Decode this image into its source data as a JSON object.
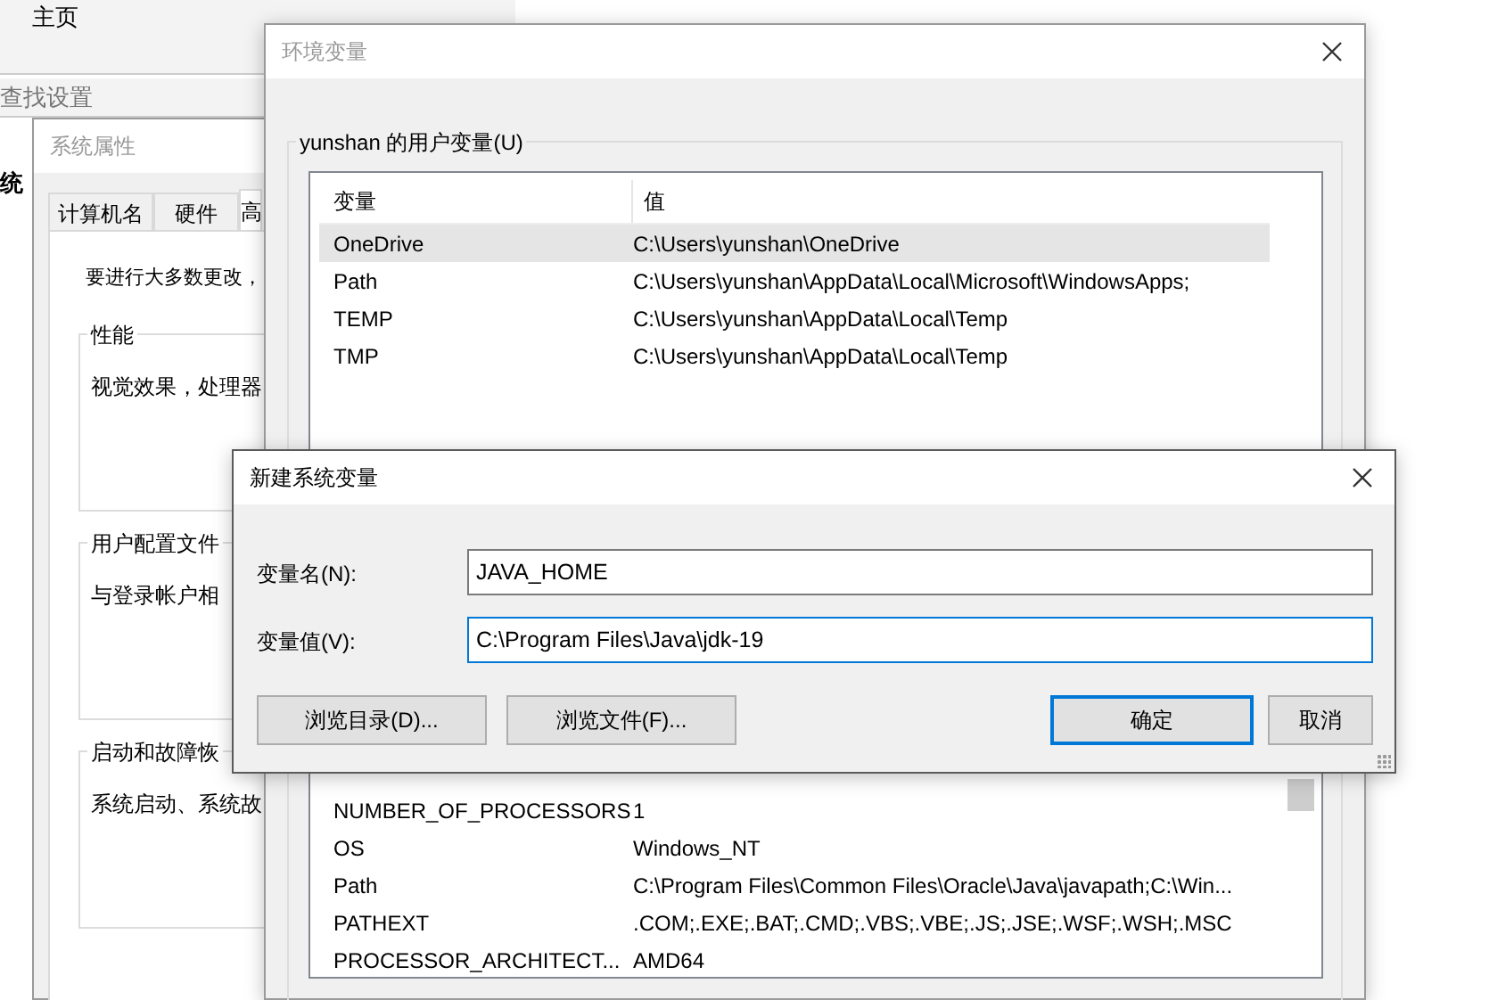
{
  "settings_window": {
    "home_label": "主页",
    "search": {
      "placeholder": "查找设置"
    },
    "side_heading": "统"
  },
  "system_properties": {
    "title": "系统属性",
    "tabs": [
      {
        "label": "计算机名",
        "selected": false
      },
      {
        "label": "硬件",
        "selected": false
      },
      {
        "label": "高",
        "selected": true
      }
    ],
    "intro": "要进行大多数更改，",
    "groups": [
      {
        "title": "性能",
        "text": "视觉效果，处理器"
      },
      {
        "title": "用户配置文件",
        "text": "与登录帐户相"
      },
      {
        "title": "启动和故障恢",
        "text": "系统启动、系统故"
      }
    ]
  },
  "environment_variables": {
    "title": "环境变量",
    "user_group": "yunshan 的用户变量(U)",
    "columns": [
      "变量",
      "值"
    ],
    "user_rows": [
      {
        "name": "OneDrive",
        "value": "C:\\Users\\yunshan\\OneDrive",
        "selected": true
      },
      {
        "name": "Path",
        "value": "C:\\Users\\yunshan\\AppData\\Local\\Microsoft\\WindowsApps;",
        "selected": false
      },
      {
        "name": "TEMP",
        "value": "C:\\Users\\yunshan\\AppData\\Local\\Temp",
        "selected": false
      },
      {
        "name": "TMP",
        "value": "C:\\Users\\yunshan\\AppData\\Local\\Temp",
        "selected": false
      }
    ],
    "system_rows": [
      {
        "name": "NUMBER_OF_PROCESSORS",
        "value": "1"
      },
      {
        "name": "OS",
        "value": "Windows_NT"
      },
      {
        "name": "Path",
        "value": "C:\\Program Files\\Common Files\\Oracle\\Java\\javapath;C:\\Win..."
      },
      {
        "name": "PATHEXT",
        "value": ".COM;.EXE;.BAT;.CMD;.VBS;.VBE;.JS;.JSE;.WSF;.WSH;.MSC"
      },
      {
        "name": "PROCESSOR_ARCHITECT...",
        "value": "AMD64"
      }
    ]
  },
  "new_variable_dialog": {
    "title": "新建系统变量",
    "fields": [
      {
        "label": "变量名(N):",
        "value": "JAVA_HOME",
        "focused": false
      },
      {
        "label": "变量值(V):",
        "value": "C:\\Program Files\\Java\\jdk-19",
        "focused": true
      }
    ],
    "buttons": [
      {
        "label": "浏览目录(D)...",
        "default": false
      },
      {
        "label": "浏览文件(F)...",
        "default": false
      },
      {
        "label": "确定",
        "default": true
      },
      {
        "label": "取消",
        "default": false
      }
    ]
  }
}
